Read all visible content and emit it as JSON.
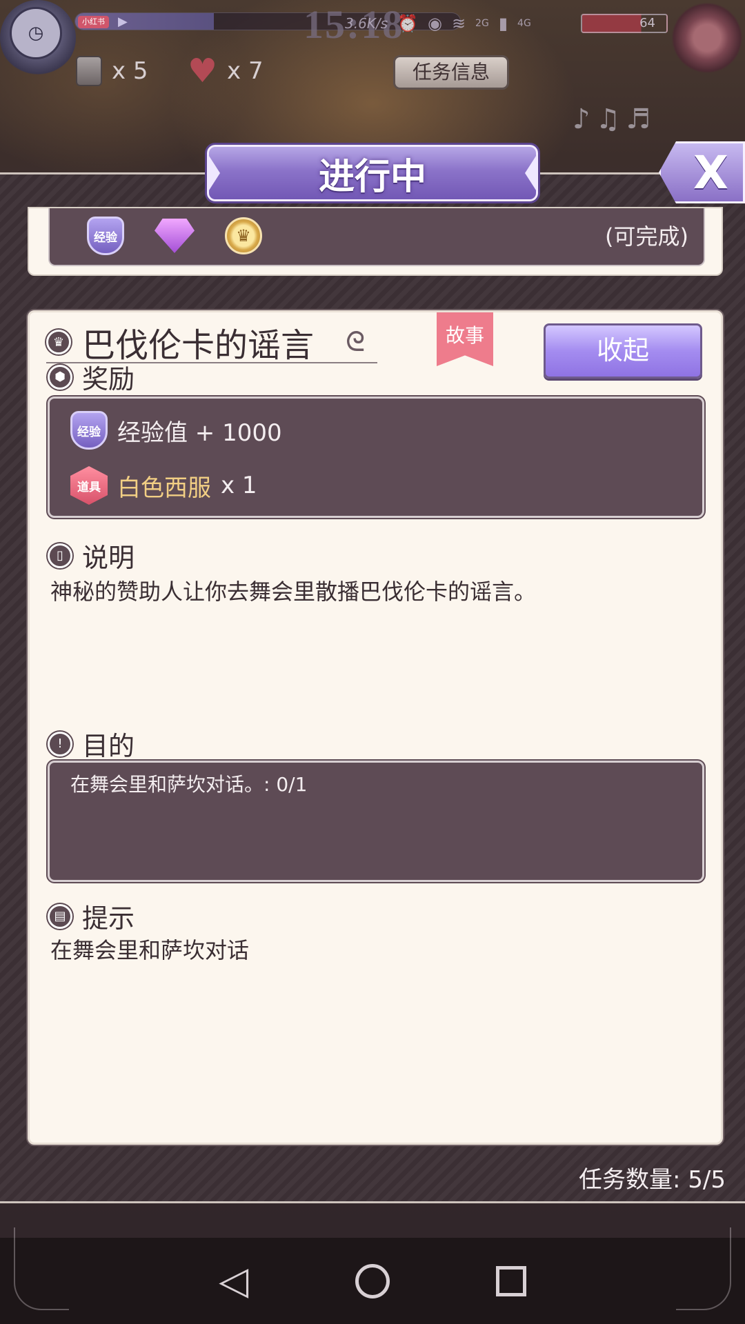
{
  "status_bar": {
    "app_tag": "小红书",
    "time": "15:18",
    "net_speed": "3.6K/s",
    "network_2g": "2G",
    "network_4g": "4G",
    "battery": "64"
  },
  "resources": {
    "scroll_count": "x 5",
    "heart_count": "x 7"
  },
  "header": {
    "task_info_button": "任务信息",
    "tab_title": "进行中",
    "close_label": "X"
  },
  "previous_quest": {
    "exp_badge": "经验",
    "status": "(可完成)"
  },
  "quest": {
    "title": "巴伐伦卡的谣言",
    "tag": "故事",
    "collapse_button": "收起",
    "reward_heading": "奖励",
    "rewards": [
      {
        "badge": "经验",
        "text": "经验值 + 1000"
      },
      {
        "badge": "道具",
        "item_name": "白色西服",
        "qty": "x 1"
      }
    ],
    "description_heading": "说明",
    "description": "神秘的赞助人让你去舞会里散播巴伐伦卡的谣言。",
    "goal_heading": "目的",
    "goal": "在舞会里和萨坎对话。: 0/1",
    "hint_heading": "提示",
    "hint": "在舞会里和萨坎对话"
  },
  "footer": {
    "task_count": "任务数量:  5/5"
  },
  "icons": {
    "back": "back-triangle-icon",
    "home": "home-circle-icon",
    "recents": "recents-square-icon"
  }
}
